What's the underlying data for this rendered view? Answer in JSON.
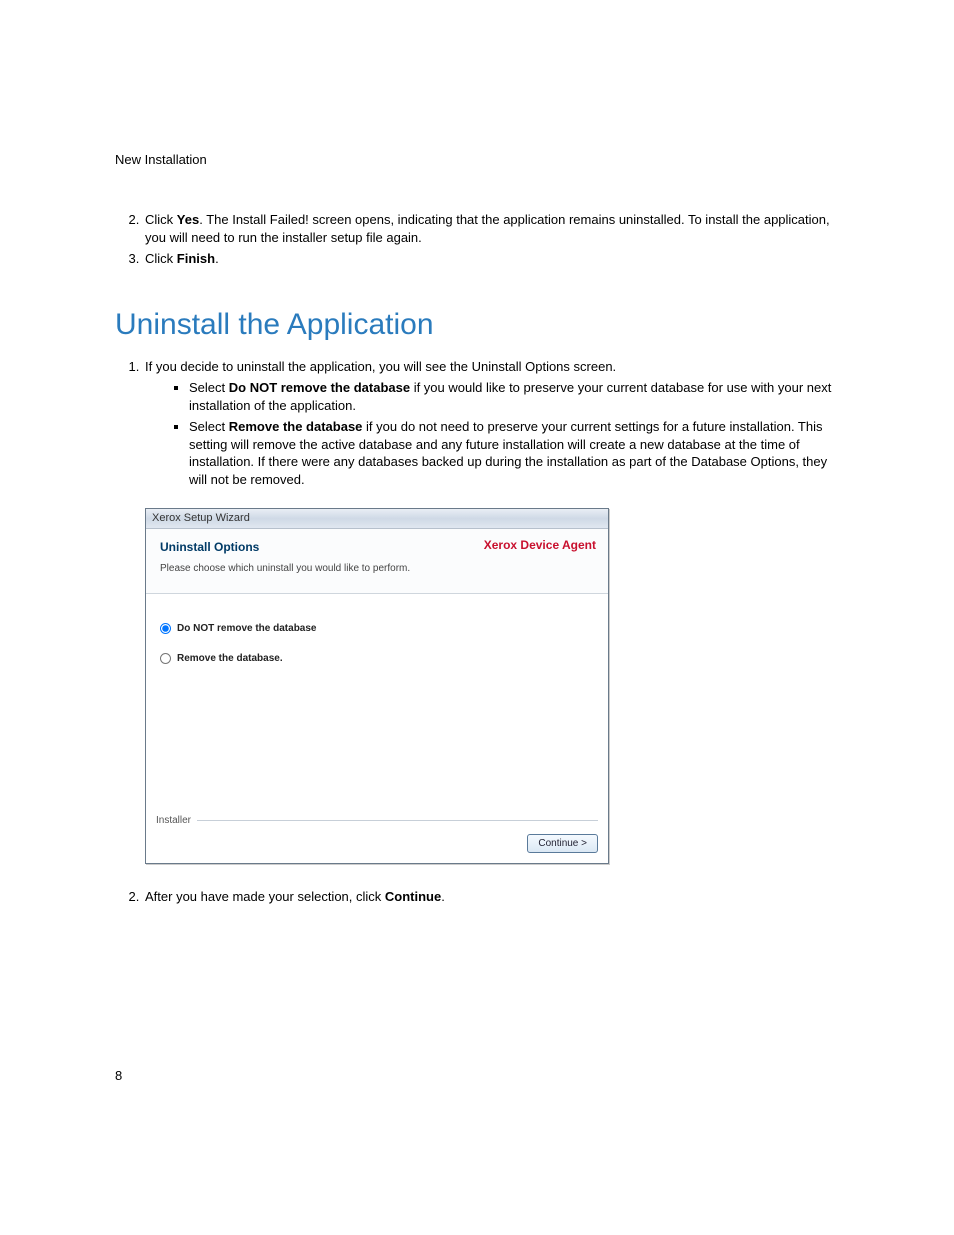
{
  "header": {
    "section": "New Installation"
  },
  "topList": {
    "item2": {
      "prefix": "Click ",
      "bold": "Yes",
      "rest": ". The Install Failed! screen opens, indicating that the application remains uninstalled. To install the application, you will need to run the installer setup file again."
    },
    "item3": {
      "prefix": "Click ",
      "bold": "Finish",
      "suffix": "."
    }
  },
  "heading": "Uninstall the Application",
  "mainList": {
    "item1": "If you decide to uninstall the application, you will see the Uninstall Options screen.",
    "bullets": {
      "b1": {
        "prefix": "Select ",
        "bold": "Do NOT remove the database",
        "rest": " if you would like to preserve your current database for use with your next installation of the application."
      },
      "b2": {
        "prefix": "Select ",
        "bold": "Remove the database",
        "rest": " if you do not need to preserve your current settings for a future installation. This setting will remove the active database and any future installation will create a new database at the time of installation. If there were any databases backed up during the installation as part of the Database Options, they will not be removed."
      }
    },
    "item2": {
      "prefix": "After you have made your selection, click ",
      "bold": "Continue",
      "suffix": "."
    }
  },
  "wizard": {
    "titlebar": "Xerox Setup Wizard",
    "brand": "Xerox Device Agent",
    "headerTitle": "Uninstall Options",
    "headerSub": "Please choose which uninstall you would like to perform.",
    "radio1": "Do NOT remove the database",
    "radio2": "Remove the database.",
    "footerLabel": "Installer",
    "continue": "Continue >"
  },
  "pageNumber": "8"
}
